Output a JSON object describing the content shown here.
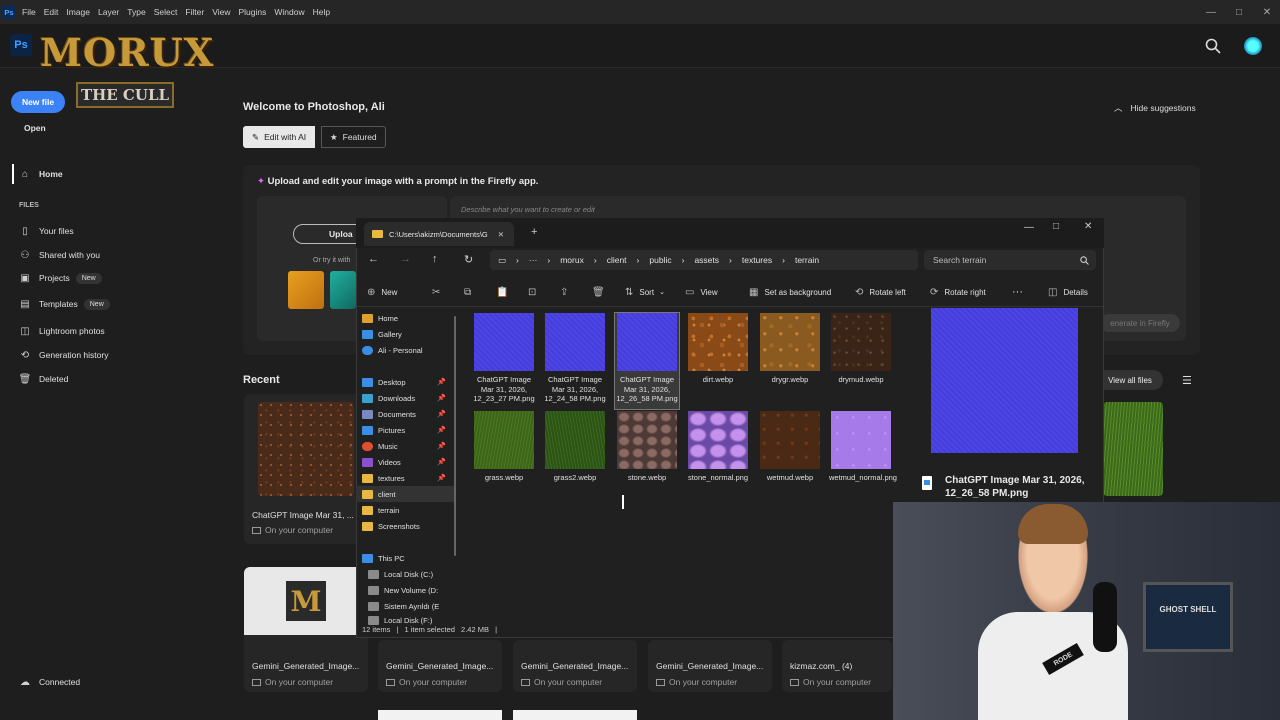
{
  "menubar": {
    "ps_icon": "Ps",
    "items": [
      "File",
      "Edit",
      "Image",
      "Layer",
      "Type",
      "Select",
      "Filter",
      "View",
      "Plugins",
      "Window",
      "Help"
    ]
  },
  "brand": {
    "ps_logo": "Ps",
    "title": "MORUX",
    "subtitle": "THE CULL"
  },
  "sidebar": {
    "new_file": "New file",
    "open": "Open",
    "home": "Home",
    "files_header": "FILES",
    "items": [
      {
        "label": "Your files",
        "icon": "file-icon"
      },
      {
        "label": "Shared with you",
        "icon": "people-icon"
      },
      {
        "label": "Projects",
        "icon": "projects-icon",
        "badge": "New"
      },
      {
        "label": "Templates",
        "icon": "template-icon",
        "badge": "New"
      },
      {
        "label": "Lightroom photos",
        "icon": "lightroom-icon"
      },
      {
        "label": "Generation history",
        "icon": "history-icon"
      },
      {
        "label": "Deleted",
        "icon": "trash-icon"
      }
    ],
    "connected": "Connected"
  },
  "main": {
    "welcome": "Welcome to Photoshop, Ali",
    "hide_suggestions": "Hide suggestions",
    "tab_edit_ai": "Edit with AI",
    "tab_featured": "Featured",
    "firefly_prompt": "Upload and edit your image with a prompt in the Firefly app.",
    "describe_placeholder": "Describe what you want to create or edit",
    "upload": "Uploa",
    "or_try": "Or try it with",
    "generate": "enerate in Firefly",
    "recent": "Recent",
    "view_all": "View all files",
    "recent_cards": [
      {
        "name": "ChatGPT Image Mar 31, ...",
        "sub": "On your computer"
      },
      {
        "name": "Gemini_Generated_Image...",
        "sub": "On your computer"
      },
      {
        "name": "Gemini_Generated_Image...",
        "sub": "On your computer"
      },
      {
        "name": "Gemini_Generated_Image...",
        "sub": "On your computer"
      },
      {
        "name": "Gemini_Generated_Image...",
        "sub": "On your computer"
      },
      {
        "name": "kizmaz.com_ (4)",
        "sub": "On your computer"
      }
    ]
  },
  "explorer": {
    "tab_title": "C:\\Users\\akizm\\Documents\\G",
    "breadcrumb": [
      "morux",
      "client",
      "public",
      "assets",
      "textures",
      "terrain"
    ],
    "search_placeholder": "Search terrain",
    "toolbar": {
      "new": "New",
      "sort": "Sort",
      "view": "View",
      "set_background": "Set as background",
      "rotate_left": "Rotate left",
      "rotate_right": "Rotate right",
      "details": "Details"
    },
    "nav": [
      {
        "label": "Home",
        "color": "#e0a030"
      },
      {
        "label": "Gallery",
        "color": "#3a8ee6"
      },
      {
        "label": "Ali - Personal",
        "color": "#3a8ee6"
      },
      {
        "label": "Desktop",
        "color": "#3a8ee6",
        "pin": true
      },
      {
        "label": "Downloads",
        "color": "#3aa0d0",
        "pin": true
      },
      {
        "label": "Documents",
        "color": "#7a8ac0",
        "pin": true
      },
      {
        "label": "Pictures",
        "color": "#3a8ee6",
        "pin": true
      },
      {
        "label": "Music",
        "color": "#e05030",
        "pin": true
      },
      {
        "label": "Videos",
        "color": "#8a50d0",
        "pin": true
      },
      {
        "label": "textures",
        "color": "#e8b840",
        "pin": true
      },
      {
        "label": "client",
        "color": "#e8b840"
      },
      {
        "label": "terrain",
        "color": "#e8b840"
      },
      {
        "label": "Screenshots",
        "color": "#e8b840"
      },
      {
        "label": "This PC",
        "color": "#3a8ee6"
      },
      {
        "label": "Local Disk (C:)",
        "color": "#8a8a8a"
      },
      {
        "label": "New Volume (D:",
        "color": "#8a8a8a"
      },
      {
        "label": "Sistem Ayrıldı (E",
        "color": "#8a8a8a"
      },
      {
        "label": "Local Disk (F:)",
        "color": "#8a8a8a"
      }
    ],
    "files": [
      {
        "name": "ChatGPT Image Mar 31, 2026, 12_23_27 PM.png",
        "texture": "normal"
      },
      {
        "name": "ChatGPT Image Mar 31, 2026, 12_24_58 PM.png",
        "texture": "normal"
      },
      {
        "name": "ChatGPT Image Mar 31, 2026, 12_26_58 PM.png",
        "texture": "normal"
      },
      {
        "name": "dirt.webp",
        "texture": "dirt"
      },
      {
        "name": "drygr.webp",
        "texture": "drygr"
      },
      {
        "name": "drymud.webp",
        "texture": "drymud"
      },
      {
        "name": "grass.webp",
        "texture": "grass"
      },
      {
        "name": "grass2.webp",
        "texture": "grass2"
      },
      {
        "name": "stone.webp",
        "texture": "stone"
      },
      {
        "name": "stone_normal.png",
        "texture": "stonen"
      },
      {
        "name": "wetmud.webp",
        "texture": "wetmud"
      },
      {
        "name": "wetmud_normal.png",
        "texture": "wetmudn"
      }
    ],
    "preview_name": "ChatGPT Image Mar 31, 2026, 12_26_58 PM.png",
    "status": {
      "items": "12 items",
      "selected": "1 item selected",
      "size": "2.42 MB"
    }
  },
  "webcam": {
    "poster": "GHOST SHELL",
    "mic_brand": "RODE"
  }
}
